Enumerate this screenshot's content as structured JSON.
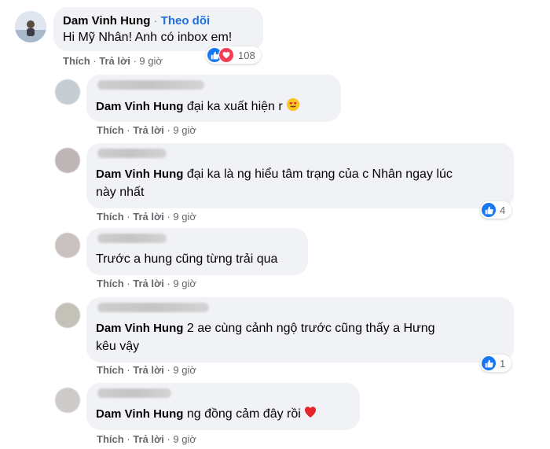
{
  "main_comment": {
    "author": "Dam Vinh Hung",
    "follow_label": "Theo dõi",
    "separator": "·",
    "text": "Hi Mỹ Nhân! Anh có inbox em!",
    "reaction_count": "108",
    "like_label": "Thích",
    "reply_label": "Trả lời",
    "time": "9 giờ"
  },
  "replies": [
    {
      "mention": "Dam Vinh Hung",
      "text": " đại ka xuất hiện r",
      "reaction_count": "",
      "like_label": "Thích",
      "reply_label": "Trả lời",
      "time": "9 giờ"
    },
    {
      "mention": "Dam Vinh Hung",
      "text": " đại ka là ng hiểu tâm trạng của c Nhân ngay lúc",
      "text2": "này nhất",
      "reaction_count": "4",
      "like_label": "Thích",
      "reply_label": "Trả lời",
      "time": "9 giờ"
    },
    {
      "mention": "",
      "text": "Trước a hung cũng từng trải qua",
      "reaction_count": "",
      "like_label": "Thích",
      "reply_label": "Trả lời",
      "time": "9 giờ"
    },
    {
      "mention": "Dam Vinh Hung",
      "text": " 2 ae cùng cảnh ngộ trước cũng thấy a Hưng",
      "text2": "kêu vậy",
      "reaction_count": "1",
      "like_label": "Thích",
      "reply_label": "Trả lời",
      "time": "9 giờ"
    },
    {
      "mention": "Dam Vinh Hung",
      "text": " ng đồng cảm đây rồi",
      "reaction_count": "",
      "like_label": "Thích",
      "reply_label": "Trả lời",
      "time": "9 giờ"
    }
  ],
  "colors": {
    "bubble": "#f0f2f5",
    "follow": "#216fdb",
    "meta": "#65676b",
    "like": "#1877f2",
    "love": "#f33e58"
  },
  "icons": {
    "like": "like-icon",
    "love": "love-icon",
    "heart_eyes": "heart-eyes-emoji",
    "heart": "red-heart-emoji"
  }
}
